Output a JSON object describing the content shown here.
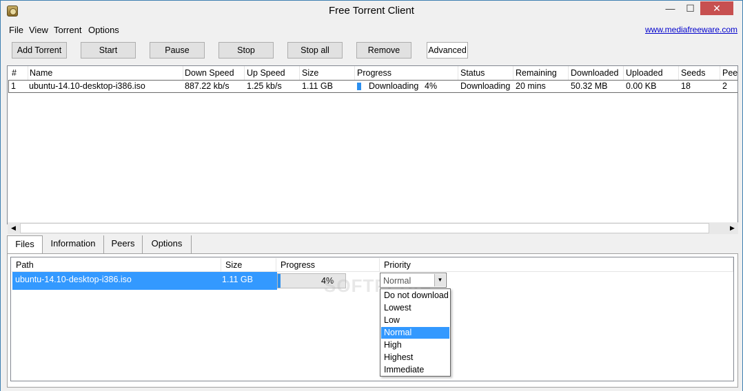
{
  "window": {
    "title": "Free Torrent Client",
    "minimize": "—",
    "maximize": "☐",
    "close": "✕"
  },
  "menu": {
    "items": [
      "File",
      "View",
      "Torrent",
      "Options"
    ],
    "link": "www.mediafreeware.com"
  },
  "toolbar": {
    "buttons": [
      "Add Torrent",
      "Start",
      "Pause",
      "Stop",
      "Stop all",
      "Remove"
    ],
    "advanced": "Advanced"
  },
  "torrents": {
    "columns": [
      "#",
      "Name",
      "Down Speed",
      "Up Speed",
      "Size",
      "Progress",
      "Status",
      "Remaining",
      "Downloaded",
      "Uploaded",
      "Seeds",
      "Peers"
    ],
    "rows": [
      {
        "num": "1",
        "name": "ubuntu-14.10-desktop-i386.iso",
        "down_speed": "887.22 kb/s",
        "up_speed": "1.25 kb/s",
        "size": "1.11 GB",
        "progress_label": "Downloading",
        "progress_percent": "4%",
        "progress_value": 0.04,
        "status": "Downloading",
        "remaining": "20 mins",
        "downloaded": "50.32 MB",
        "uploaded": "0.00 KB",
        "seeds": "18",
        "peers": "2"
      }
    ]
  },
  "tabs": [
    "Files",
    "Information",
    "Peers",
    "Options"
  ],
  "files": {
    "columns": [
      "Path",
      "Size",
      "Progress",
      "Priority"
    ],
    "rows": [
      {
        "path": "ubuntu-14.10-desktop-i386.iso",
        "size": "1.11 GB",
        "progress": "4%",
        "progress_value": 0.04,
        "priority": "Normal"
      }
    ]
  },
  "priority_options": [
    "Do not download",
    "Lowest",
    "Low",
    "Normal",
    "High",
    "Highest",
    "Immediate"
  ],
  "priority_selected": "Normal",
  "watermark": "SOFTPEDIA",
  "colors": {
    "selection": "#3399ff",
    "progress": "#2b8fef",
    "close": "#c75050"
  }
}
